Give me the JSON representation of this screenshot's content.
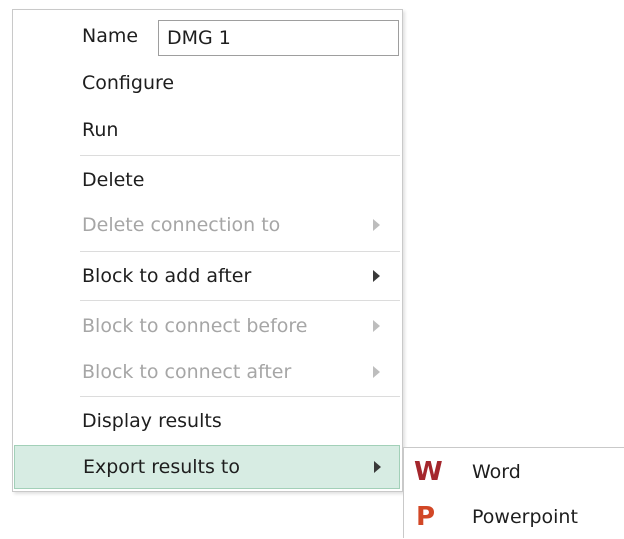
{
  "context_menu": {
    "name_label": "Name",
    "name_value": "DMG 1",
    "items": {
      "configure": "Configure",
      "run": "Run",
      "delete": "Delete",
      "delete_connection_to": "Delete connection to",
      "block_to_add_after": "Block to add after",
      "block_to_connect_before": "Block to connect before",
      "block_to_connect_after": "Block to connect after",
      "display_results": "Display results",
      "export_results_to": "Export results to"
    },
    "highlight_color": "#d7ece3",
    "disabled_color": "#a6a6a6"
  },
  "export_submenu": {
    "word": {
      "icon_glyph": "W",
      "icon": "word-icon",
      "label": "Word",
      "color": "#a4262c"
    },
    "powerpoint": {
      "icon_glyph": "P",
      "icon": "powerpoint-icon",
      "label": "Powerpoint",
      "color": "#d24726"
    }
  }
}
